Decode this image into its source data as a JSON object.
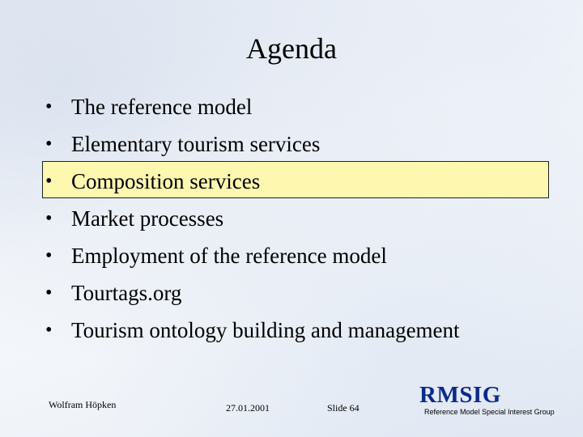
{
  "slide": {
    "title": "Agenda",
    "items": [
      "The reference model",
      "Elementary tourism services",
      "Composition services",
      "Market processes",
      "Employment of the reference model",
      "Tourtags.org",
      "Tourism ontology building and management"
    ],
    "bullet_char": "•",
    "highlight_color": "#fdf7b0"
  },
  "footer": {
    "author": "Wolfram Höpken",
    "date": "27.01.2001",
    "slide_number": "Slide 64",
    "logo_text": "RMSIG",
    "logo_subtitle": "Reference Model Special Interest Group",
    "logo_color": "#0a2a8c"
  }
}
